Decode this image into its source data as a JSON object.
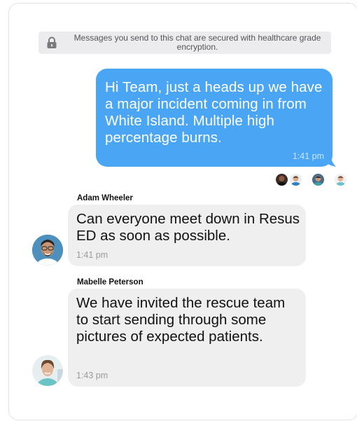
{
  "security_banner": {
    "text": "Messages you send to this chat are secured with healthcare grade encryption.",
    "icon": "lock-icon"
  },
  "messages": [
    {
      "direction": "outgoing",
      "text": "Hi Team, just a heads up we have a major incident coming in from White Island. Multiple high percentage burns.",
      "time": "1:41 pm"
    },
    {
      "direction": "incoming",
      "sender": "Adam Wheeler",
      "text": "Can everyone meet down in Resus ED as soon as possible.",
      "time": "1:41 pm"
    },
    {
      "direction": "incoming",
      "sender": "Mabelle Peterson",
      "text": "We have invited the rescue team to start sending through some pictures of expected patients.",
      "time": "1:43 pm"
    }
  ],
  "colors": {
    "outgoing_bubble": "#4aa6f5",
    "incoming_bubble": "#efeff0",
    "banner": "#ececee"
  }
}
